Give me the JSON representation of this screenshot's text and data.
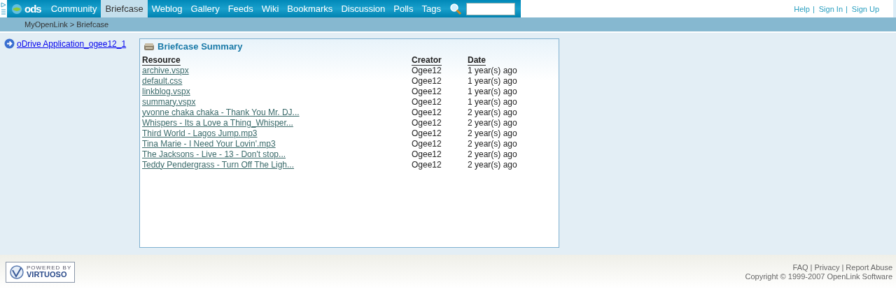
{
  "top_nav": {
    "logo": "ods",
    "tabs": [
      {
        "label": "Community",
        "selected": false
      },
      {
        "label": "Briefcase",
        "selected": true
      },
      {
        "label": "Weblog",
        "selected": false
      },
      {
        "label": "Gallery",
        "selected": false
      },
      {
        "label": "Feeds",
        "selected": false
      },
      {
        "label": "Wiki",
        "selected": false
      },
      {
        "label": "Bookmarks",
        "selected": false
      },
      {
        "label": "Discussion",
        "selected": false
      },
      {
        "label": "Polls",
        "selected": false
      },
      {
        "label": "Tags",
        "selected": false
      }
    ],
    "user_links": [
      {
        "label": "Help",
        "separator": "|"
      },
      {
        "label": "Sign In",
        "separator": "|"
      },
      {
        "label": "Sign Up"
      }
    ]
  },
  "breadcrumb": "MyOpenLink > Briefcase",
  "sidebar": {
    "link": "oDrive Application_ogee12_1"
  },
  "panel": {
    "title": "Briefcase Summary",
    "columns": [
      "Resource",
      "Creator",
      "Date"
    ],
    "rows": [
      [
        "archive.vspx",
        "Ogee12",
        "1 year(s) ago"
      ],
      [
        "default.css",
        "Ogee12",
        "1 year(s) ago"
      ],
      [
        "linkblog.vspx",
        "Ogee12",
        "1 year(s) ago"
      ],
      [
        "summary.vspx",
        "Ogee12",
        "1 year(s) ago"
      ],
      [
        "yvonne chaka chaka - Thank You Mr. DJ...",
        "Ogee12",
        "2 year(s) ago"
      ],
      [
        "Whispers - Its a Love a Thing_Whisper...",
        "Ogee12",
        "2 year(s) ago"
      ],
      [
        "Third World - Lagos Jump.mp3",
        "Ogee12",
        "2 year(s) ago"
      ],
      [
        "Tina Marie - I Need Your Lovin'.mp3",
        "Ogee12",
        "2 year(s) ago"
      ],
      [
        "The Jacksons - Live - 13 - Don't stop...",
        "Ogee12",
        "2 year(s) ago"
      ],
      [
        "Teddy Pendergrass - Turn Off The Ligh...",
        "Ogee12",
        "2 year(s) ago"
      ]
    ]
  },
  "footer": {
    "badge_top": "POWERED BY",
    "badge_bottom": "VIRTUOSO",
    "links": [
      {
        "label": "FAQ",
        "separator": "|"
      },
      {
        "label": "Privacy",
        "separator": "|"
      },
      {
        "label": "Report Abuse"
      }
    ],
    "copyright": "Copyright © 1999-2007 OpenLink Software"
  }
}
